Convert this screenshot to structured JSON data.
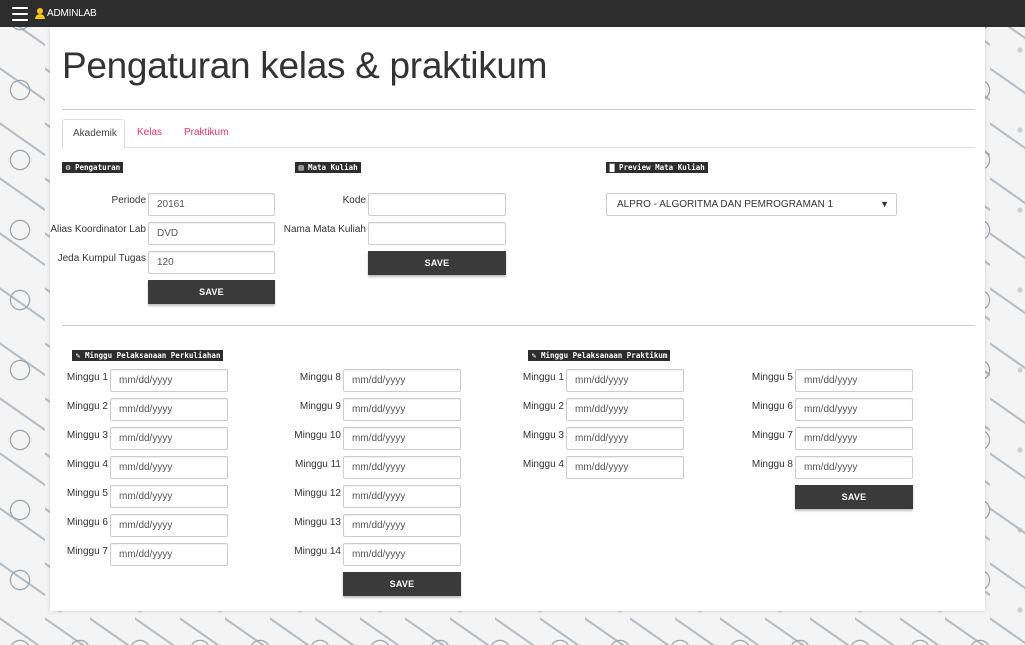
{
  "topbar": {
    "brand": "ADMINLAB"
  },
  "page": {
    "title": "Pengaturan kelas & praktikum"
  },
  "tabs": [
    {
      "label": "Akademik",
      "active": true
    },
    {
      "label": "Kelas",
      "active": false
    },
    {
      "label": "Praktikum",
      "active": false
    }
  ],
  "pengaturan": {
    "heading": "Pengaturan",
    "fields": [
      {
        "label": "Periode",
        "value": "20161"
      },
      {
        "label": "Alias Koordinator Lab",
        "value": "DVD"
      },
      {
        "label": "Jeda Kumpul Tugas",
        "value": "120"
      }
    ],
    "save_label": "SAVE"
  },
  "mata_kuliah": {
    "heading": "Mata Kuliah",
    "fields": [
      {
        "label": "Kode",
        "value": ""
      },
      {
        "label": "Nama Mata Kuliah",
        "value": ""
      }
    ],
    "save_label": "SAVE"
  },
  "preview": {
    "heading": "Preview Mata Kuliah",
    "selected": "ALPRO - ALGORITMA DAN PEMROGRAMAN 1"
  },
  "perkuliahan": {
    "heading": "Minggu Pelaksanaan Perkuliahan",
    "placeholder": "mm/dd/yyyy",
    "weeks": [
      "Minggu 1",
      "Minggu 2",
      "Minggu 3",
      "Minggu 4",
      "Minggu 5",
      "Minggu 6",
      "Minggu 7",
      "Minggu 8",
      "Minggu 9",
      "Minggu 10",
      "Minggu 11",
      "Minggu 12",
      "Minggu 13",
      "Minggu 14"
    ],
    "save_label": "SAVE"
  },
  "praktikum": {
    "heading": "Minggu Pelaksanaan Praktikum",
    "placeholder": "mm/dd/yyyy",
    "weeks": [
      "Minggu 1",
      "Minggu 2",
      "Minggu 3",
      "Minggu 4",
      "Minggu 5",
      "Minggu 6",
      "Minggu 7",
      "Minggu 8"
    ],
    "save_label": "SAVE"
  },
  "colors": {
    "topbar": "#2d2d2d",
    "accent": "#e6336e",
    "button": "#3a3a3a"
  },
  "icons": {
    "pengaturan": "gear-icon",
    "mata_kuliah": "book-icon",
    "preview": "document-icon",
    "perkuliahan": "pencil-icon",
    "praktikum": "pencil-icon",
    "menu": "hamburger-icon",
    "user": "user-icon"
  }
}
